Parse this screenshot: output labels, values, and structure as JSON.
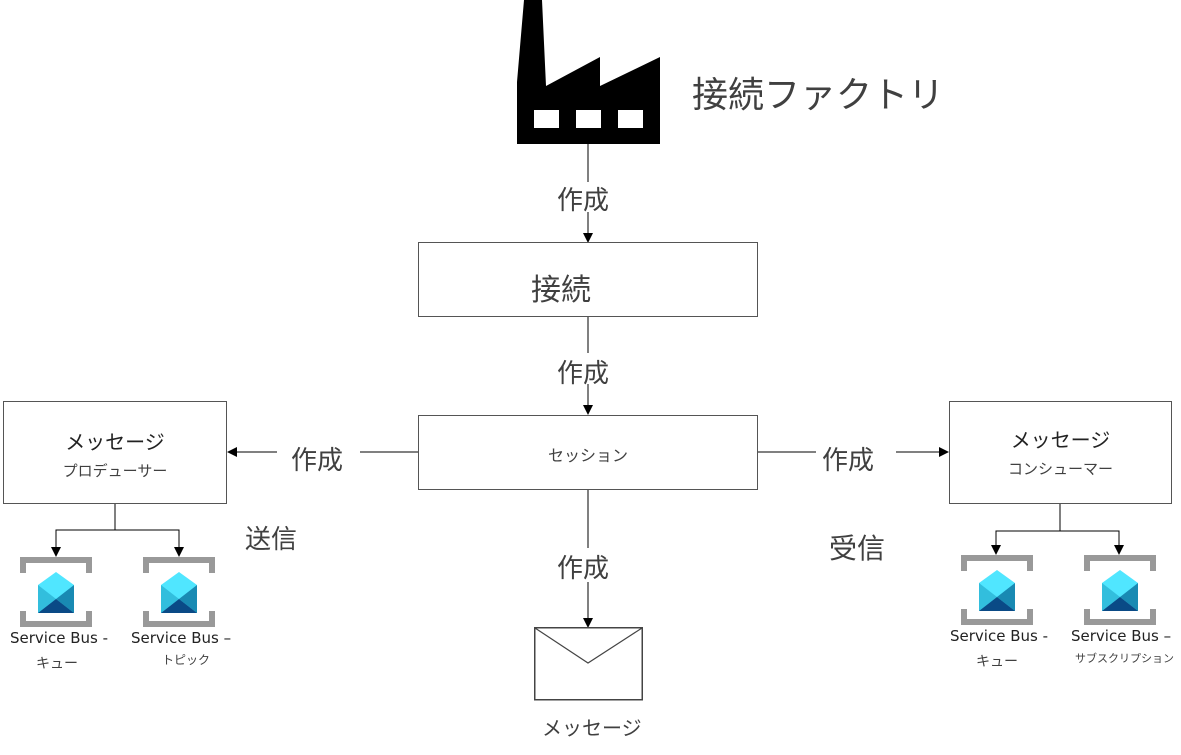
{
  "factory": {
    "icon": "factory-icon",
    "label": "接続ファクトリ"
  },
  "edges": {
    "factory_to_connection": "作成",
    "connection_to_session": "作成",
    "session_to_producer": "作成",
    "session_to_consumer": "作成",
    "session_to_message": "作成",
    "send": "送信",
    "receive": "受信"
  },
  "connection": {
    "label": "接続"
  },
  "session": {
    "label": "セッション"
  },
  "producer": {
    "title": "メッセージ",
    "subtitle": "プロデューサー"
  },
  "consumer": {
    "title": "メッセージ",
    "subtitle": "コンシューマー"
  },
  "message": {
    "icon": "envelope-icon",
    "label": "メッセージ"
  },
  "producer_targets": [
    {
      "icon": "service-bus-icon",
      "line1": "Service Bus -",
      "line2": "キュー"
    },
    {
      "icon": "service-bus-icon",
      "line1": "Service Bus –",
      "line2": "トピック"
    }
  ],
  "consumer_targets": [
    {
      "icon": "service-bus-icon",
      "line1": "Service Bus -",
      "line2": "キュー"
    },
    {
      "icon": "service-bus-icon",
      "line1": "Service Bus –",
      "line2": "サブスクリプション"
    }
  ],
  "colors": {
    "line": "#000000",
    "box_border": "#555555",
    "text": "#404040",
    "sb_bracket": "#999999",
    "sb_light": "#50e6ff",
    "sb_mid": "#32bedd",
    "sb_dark": "#198ab3",
    "sb_darkest": "#0a4a86"
  }
}
